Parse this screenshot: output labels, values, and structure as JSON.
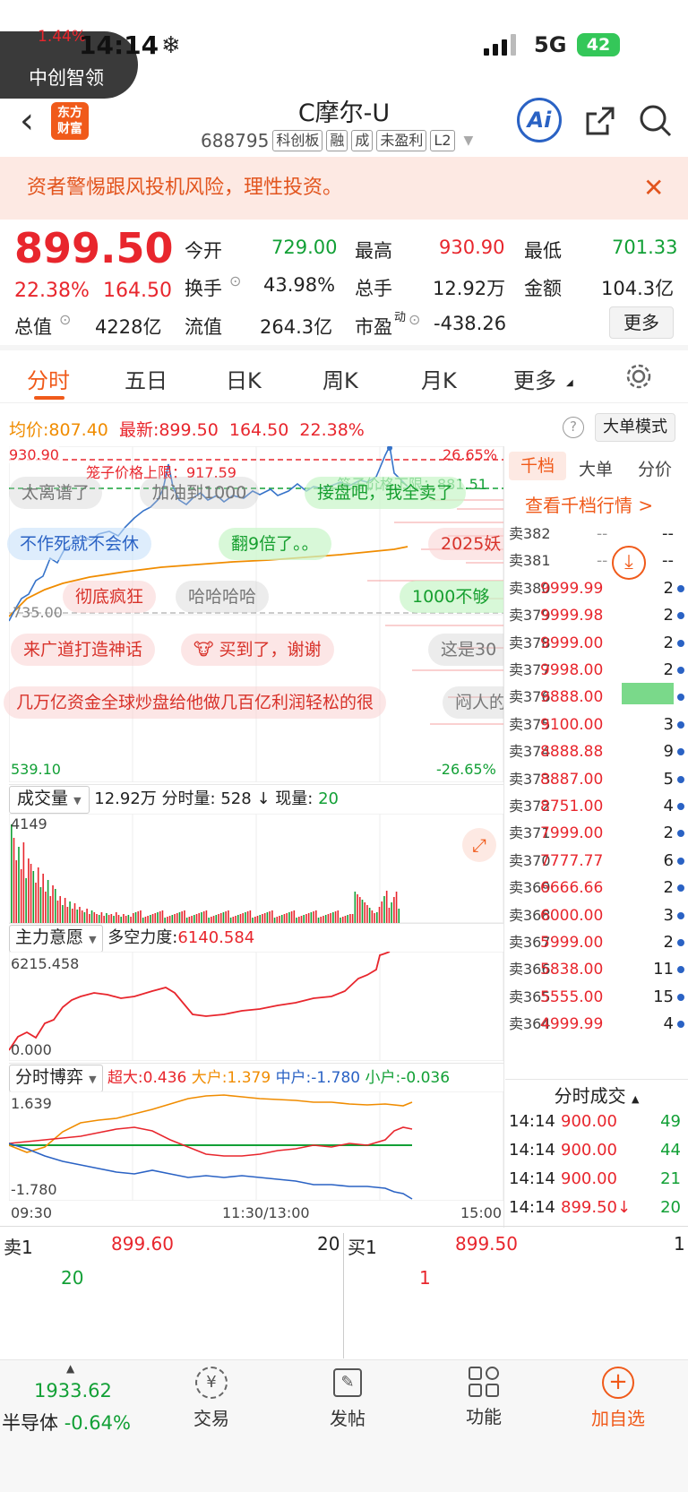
{
  "status_bar": {
    "time": "14:14",
    "network": "5G",
    "battery": "42",
    "float_change": "1.44%",
    "float_name": "中创智领"
  },
  "header": {
    "title": "C摩尔-U",
    "code": "688795",
    "tags": [
      "科创板",
      "融",
      "成",
      "未盈利",
      "L2"
    ],
    "logo_line1": "东方",
    "logo_line2": "财富",
    "ai_label": "Ai"
  },
  "banner": {
    "text": "资者警惕跟风投机风险，理性投资。"
  },
  "quote": {
    "price": "899.50",
    "change_pct": "22.38%",
    "change": "164.50",
    "open_label": "今开",
    "open": "729.00",
    "high_label": "最高",
    "high": "930.90",
    "low_label": "最低",
    "low": "701.33",
    "turnover_label": "换手",
    "turnover": "43.98%",
    "volume_label": "总手",
    "volume": "12.92万",
    "amount_label": "金额",
    "amount": "104.3亿",
    "mktcap_label": "总值",
    "mktcap": "4228亿",
    "float_label": "流值",
    "float": "264.3亿",
    "pe_label": "市盈",
    "pe_sup": "动",
    "pe": "-438.26",
    "more_label": "更多"
  },
  "tabs": [
    "分时",
    "五日",
    "日K",
    "周K",
    "月K",
    "更多"
  ],
  "chart_info": {
    "avg_label": "均价:",
    "avg": "807.40",
    "latest_label": "最新:",
    "latest": "899.50",
    "chg": "164.50",
    "chg_pct": "22.38%",
    "mode_label": "大单模式"
  },
  "intraday": {
    "top_price": "930.90",
    "top_pct": "26.65%",
    "mid_price": "735.00",
    "bottom_price": "539.10",
    "bottom_pct": "-26.65%",
    "upper_limit_label": "笼子价格上限：917.59",
    "lower_limit_label": "笼子价格下限：881.51",
    "time_start": "09:30",
    "time_mid": "11:30/13:00",
    "time_end": "15:00"
  },
  "danmaku": [
    "太离谱了",
    "加油到1000",
    "接盘吧，我全卖了",
    "不作死就不会休",
    "翻9倍了。。",
    "2025妖",
    "彻底疯狂",
    "哈哈哈哈",
    "1000不够",
    "来广道打造神话",
    "买到了，谢谢",
    "这是30",
    "几万亿资金全球炒盘给他做几百亿利润轻松的很",
    "闷人的"
  ],
  "volume_panel": {
    "label": "成交量",
    "total": "12.92万",
    "fen_label": "分时量:",
    "fen": "528",
    "now_label": "现量:",
    "now": "20",
    "max": "4149"
  },
  "force_panel": {
    "label": "主力意愿",
    "duokong_label": "多空力度:",
    "duokong": "6140.584",
    "max": "6215.458",
    "min": "0.000"
  },
  "game_panel": {
    "label": "分时博弈",
    "super_label": "超大:",
    "super": "0.436",
    "big_label": "大户:",
    "big": "1.379",
    "mid_label": "中户:",
    "mid": "-1.780",
    "small_label": "小户:",
    "small": "-0.036",
    "max": "1.639",
    "min": "-1.780"
  },
  "orderbook_tabs": [
    "千档",
    "大单",
    "分价"
  ],
  "orderbook_link": "查看千档行情 >",
  "orderbook": [
    {
      "label": "卖382",
      "price": "--",
      "qty": "--"
    },
    {
      "label": "卖381",
      "price": "--",
      "qty": "--"
    },
    {
      "label": "卖380",
      "price": "9999.99",
      "qty": "2"
    },
    {
      "label": "卖379",
      "price": "9999.98",
      "qty": "2"
    },
    {
      "label": "卖378",
      "price": "9999.00",
      "qty": "2"
    },
    {
      "label": "卖377",
      "price": "9998.00",
      "qty": "2"
    },
    {
      "label": "卖376",
      "price": "9888.00",
      "qty": "118"
    },
    {
      "label": "卖375",
      "price": "9100.00",
      "qty": "3"
    },
    {
      "label": "卖374",
      "price": "8888.88",
      "qty": "9"
    },
    {
      "label": "卖373",
      "price": "8887.00",
      "qty": "5"
    },
    {
      "label": "卖372",
      "price": "8751.00",
      "qty": "4"
    },
    {
      "label": "卖371",
      "price": "7999.00",
      "qty": "2"
    },
    {
      "label": "卖370",
      "price": "7777.77",
      "qty": "6"
    },
    {
      "label": "卖369",
      "price": "6666.66",
      "qty": "2"
    },
    {
      "label": "卖368",
      "price": "6000.00",
      "qty": "3"
    },
    {
      "label": "卖367",
      "price": "5999.00",
      "qty": "2"
    },
    {
      "label": "卖366",
      "price": "5838.00",
      "qty": "11"
    },
    {
      "label": "卖365",
      "price": "5555.00",
      "qty": "15"
    },
    {
      "label": "卖364",
      "price": "4999.99",
      "qty": "4"
    }
  ],
  "trades_header": "分时成交",
  "trades": [
    {
      "time": "14:14",
      "price": "900.00",
      "qty": "49"
    },
    {
      "time": "14:14",
      "price": "900.00",
      "qty": "44"
    },
    {
      "time": "14:14",
      "price": "900.00",
      "qty": "21"
    },
    {
      "time": "14:14",
      "price": "899.50↓",
      "qty": "20"
    }
  ],
  "level1": {
    "sell_label": "卖1",
    "sell_price": "899.60",
    "sell_qty": "20",
    "buy_label": "买1",
    "buy_price": "899.50",
    "buy_qty": "1",
    "sell_sub": "20",
    "buy_sub": "1"
  },
  "bottom_bar": {
    "index_value": "1933.62",
    "index_name": "半导体",
    "index_chg": "-0.64%",
    "trade_label": "交易",
    "post_label": "发帖",
    "func_label": "功能",
    "add_label": "加自选"
  }
}
